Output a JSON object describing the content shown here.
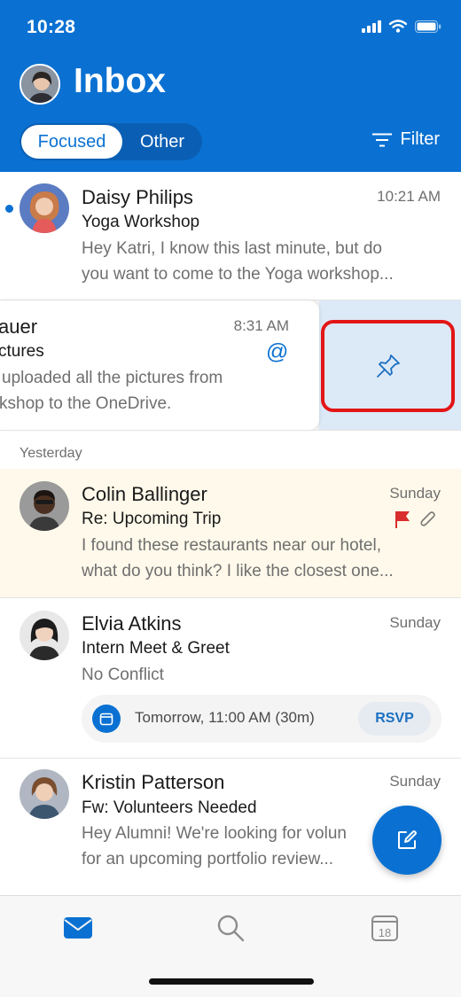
{
  "status_bar": {
    "time": "10:28",
    "icons": [
      "signal-icon",
      "wifi-icon",
      "battery-icon"
    ]
  },
  "header": {
    "title": "Inbox",
    "tabs": [
      {
        "label": "Focused",
        "selected": true
      },
      {
        "label": "Other",
        "selected": false
      }
    ],
    "filter_label": "Filter",
    "accent_color": "#0a71d2"
  },
  "messages": [
    {
      "sender": "Daisy Philips",
      "time": "10:21 AM",
      "subject": "Yoga Workshop",
      "preview_line1": "Hey Katri, I know this last minute, but do",
      "preview_line2": "you want to come to the Yoga workshop...",
      "unread": true
    },
    {
      "sender": "auer",
      "time": "8:31 AM",
      "subject": "ctures",
      "preview_line1": "uploaded all the pictures from",
      "preview_line2": "kshop to the OneDrive.",
      "mention_icon": "@",
      "swipe_action": "pin-icon"
    }
  ],
  "section_yesterday": "Yesterday",
  "messages_yesterday": [
    {
      "sender": "Colin Ballinger",
      "time": "Sunday",
      "subject": "Re: Upcoming Trip",
      "preview_line1": "I found these restaurants near our hotel,",
      "preview_line2": "what do you think? I like the closest one...",
      "flagged": true,
      "attachment": true,
      "highlight_color": "#fef9ea",
      "flag_color": "#d92c2c"
    },
    {
      "sender": "Elvia Atkins",
      "time": "Sunday",
      "subject": "Intern Meet & Greet",
      "preview_line1": "No Conflict",
      "event_text": "Tomorrow, 11:00 AM (30m)",
      "rsvp_label": "RSVP"
    },
    {
      "sender": "Kristin Patterson",
      "time": "Sunday",
      "subject": "Fw: Volunteers Needed",
      "preview_line1": "Hey Alumni! We're looking for volun",
      "preview_line2": "for an upcoming portfolio review..."
    }
  ],
  "calendar_tab_day": "18"
}
